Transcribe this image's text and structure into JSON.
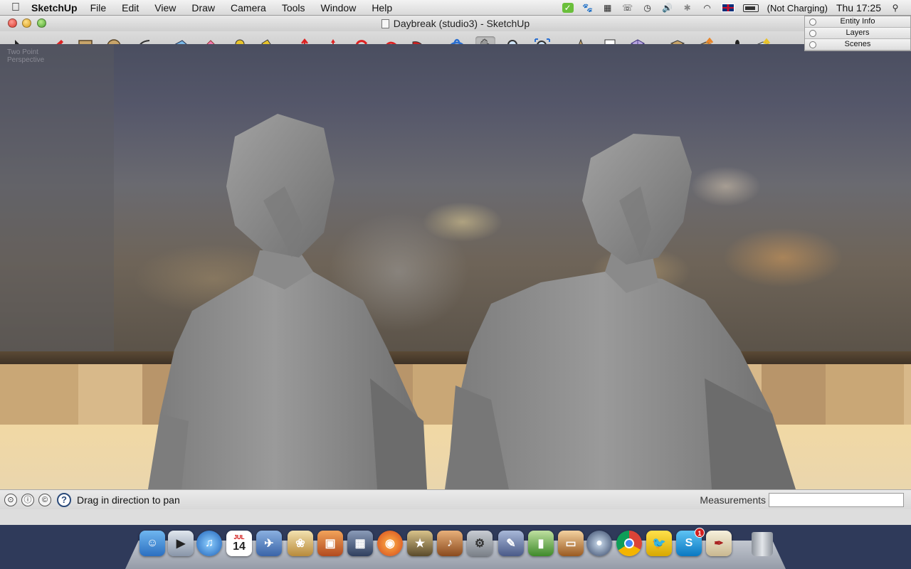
{
  "menubar": {
    "apple": "",
    "app_name": "SketchUp",
    "menus": [
      "File",
      "Edit",
      "View",
      "Draw",
      "Camera",
      "Tools",
      "Window",
      "Help"
    ],
    "battery_status": "(Not Charging)",
    "clock": "Thu 17:25"
  },
  "window": {
    "title": "Daybreak (studio3) - SketchUp"
  },
  "toolbar": {
    "tools": [
      "select-icon",
      "pencil-icon",
      "rectangle-icon",
      "circle-icon",
      "arc-icon",
      "make-component-icon",
      "eraser-icon",
      "tape-measure-icon",
      "paint-bucket-icon",
      "push-pull-icon",
      "move-icon",
      "rotate-icon",
      "follow-me-icon",
      "offset-icon",
      "orbit-icon",
      "pan-icon",
      "zoom-icon",
      "zoom-extents-icon",
      "3d-text-icon",
      "dimension-icon",
      "section-plane-icon",
      "get-models-icon",
      "share-model-icon",
      "walk-icon",
      "share-component-icon"
    ]
  },
  "palette": {
    "items": [
      "Entity Info",
      "Layers",
      "Scenes"
    ]
  },
  "viewport": {
    "perspective_line1": "Two Point",
    "perspective_line2": "Perspective"
  },
  "statusbar": {
    "hint": "Drag in direction to pan",
    "measurements_label": "Measurements",
    "measurements_value": ""
  },
  "dock": {
    "apps": [
      "Finder",
      "FaceTime",
      "iTunes",
      "iCal",
      "Preview",
      "iPhoto",
      "Photos",
      "Dashboard",
      "Firefox",
      "iMovie",
      "GarageBand",
      "System Preferences",
      "Script Editor",
      "Numbers",
      "Keynote",
      "DVD Player",
      "Chrome",
      "Twitterrific",
      "Skype",
      "TextEdit",
      "Trash"
    ],
    "skype_badge": "1",
    "ical_date": "14",
    "ical_month": "JUL"
  }
}
